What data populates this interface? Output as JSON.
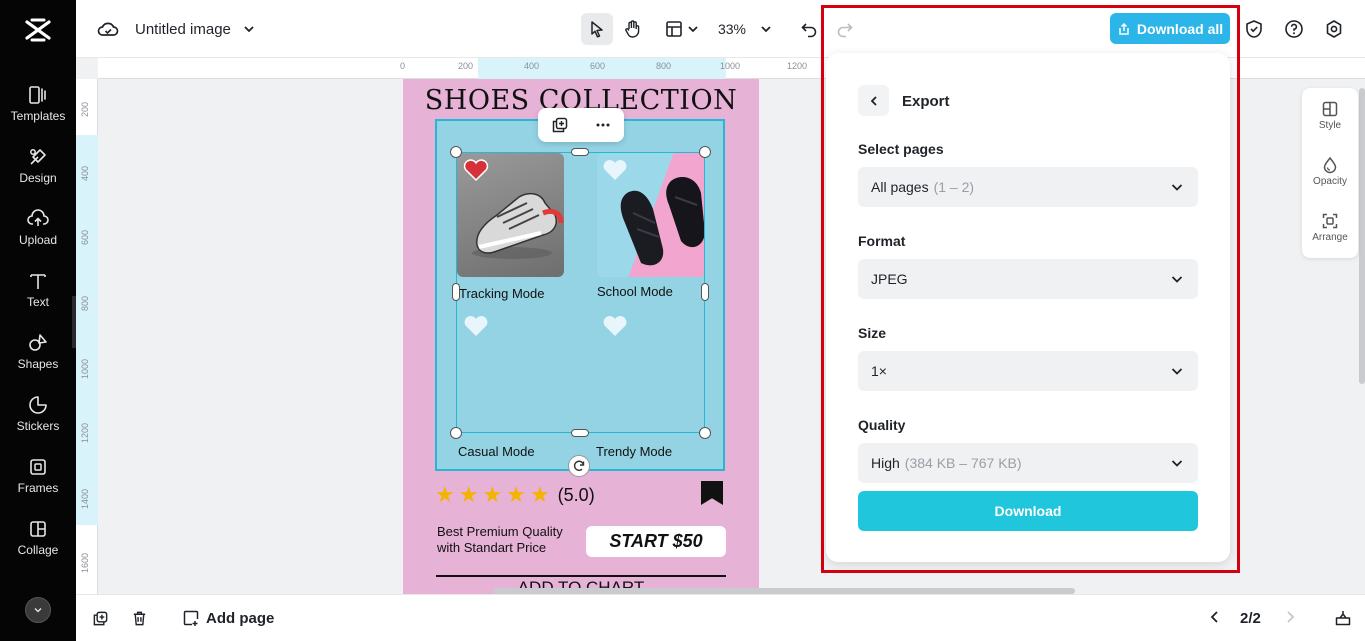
{
  "sidebar": {
    "logo_icon": "capcut-logo-icon",
    "items": [
      {
        "label": "Templates",
        "icon": "templates-icon"
      },
      {
        "label": "Design",
        "icon": "design-icon"
      },
      {
        "label": "Upload",
        "icon": "upload-icon"
      },
      {
        "label": "Text",
        "icon": "text-icon"
      },
      {
        "label": "Shapes",
        "icon": "shapes-icon"
      },
      {
        "label": "Stickers",
        "icon": "stickers-icon"
      },
      {
        "label": "Frames",
        "icon": "frames-icon"
      },
      {
        "label": "Collage",
        "icon": "collage-icon"
      }
    ]
  },
  "toolbar": {
    "doc_title": "Untitled image",
    "zoom": "33%",
    "download_all_label": "Download all"
  },
  "rulers": {
    "h_ticks": [
      "0",
      "200",
      "400",
      "600",
      "800",
      "1000",
      "1200"
    ],
    "v_ticks": [
      "200",
      "400",
      "600",
      "800",
      "1000",
      "1200",
      "1400",
      "1600"
    ]
  },
  "design": {
    "title": "SHOES COLLECTION",
    "modes": [
      "Tracking Mode",
      "School Mode",
      "Casual Mode",
      "Trendy Mode"
    ],
    "stars": 5,
    "rating": "(5.0)",
    "tagline_line1": "Best Premium Quality",
    "tagline_line2": "with Standart Price",
    "price": "START $50",
    "cta": "ADD TO CHART"
  },
  "properties_rail": [
    {
      "label": "Style",
      "icon": "style-icon"
    },
    {
      "label": "Opacity",
      "icon": "opacity-icon"
    },
    {
      "label": "Arrange",
      "icon": "arrange-icon"
    }
  ],
  "export": {
    "title": "Export",
    "select_pages_label": "Select pages",
    "select_pages_value": "All pages",
    "select_pages_range": "(1 – 2)",
    "format_label": "Format",
    "format_value": "JPEG",
    "size_label": "Size",
    "size_value": "1×",
    "quality_label": "Quality",
    "quality_value": "High",
    "quality_range": "(384 KB – 767 KB)",
    "download_label": "Download"
  },
  "bottombar": {
    "add_page_label": "Add page",
    "page_indicator": "2/2"
  },
  "colors": {
    "accent": "#1fc6dc",
    "download_all_bg": "#2bb5e8",
    "highlight_frame": "#d40010",
    "design_bg": "#e6b2d6",
    "design_panel": "#93d3e4"
  }
}
